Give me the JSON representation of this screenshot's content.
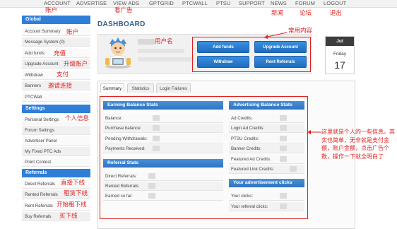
{
  "topnav": {
    "items": [
      "ACCOUNT",
      "ADVERTISE",
      "VIEW ADS",
      "GPTGRID",
      "PTCWALL",
      "PTSU",
      "SUPPORT",
      "NEWS",
      "FORUM",
      "LOGOUT"
    ]
  },
  "annotations": {
    "account": "账户",
    "view_ads": "看广告",
    "news": "新闻",
    "forum": "论坛",
    "logout": "退出",
    "username": "用户名",
    "common_content": "常用内容",
    "sidebar_account": "账户",
    "sidebar_recharge": "充值",
    "sidebar_upgrade": "升级账户",
    "sidebar_withdraw": "支付",
    "sidebar_banners": "邀请连接",
    "sidebar_personal": "个人信息",
    "sidebar_direct": "直接下线",
    "sidebar_rented": "租赁下线",
    "sidebar_rent": "开始租下线",
    "sidebar_buy": "买下线",
    "stats_note": "这里就是个人的一些信息。其实也简单，无非就是支付金额，账户金额，点击广告个数，操作一下就全明白了"
  },
  "sidebar": {
    "global_header": "Global",
    "global_items": [
      "Account Summary",
      "Message System (0)",
      "Add funds",
      "Upgrade Account",
      "Withdraw",
      "Banners",
      "PTCWall"
    ],
    "settings_header": "Settings",
    "settings_items": [
      "Personal Settings",
      "Forum Settings",
      "Advertiser Panel",
      "My Fixed PTC Ads",
      "Point Contest"
    ],
    "referrals_header": "Referrals",
    "referrals_items": [
      "Direct Referrals",
      "Rented Referrals",
      "Rent Referrals",
      "Buy Referrals"
    ]
  },
  "main": {
    "title": "DASHBOARD",
    "quick_buttons": [
      "Add funds",
      "Upgrade Account",
      "Withdraw",
      "Rent Referrals"
    ],
    "date": {
      "month": "Jul",
      "weekday": "Friday",
      "day": "17"
    },
    "tabs": [
      "Summary",
      "Statistics",
      "Login Failures"
    ],
    "earning_stats": {
      "title": "Earning Balance Stats",
      "rows": [
        "Balance:",
        "Purchase balance:",
        "Pending Withdrawals:",
        "Payments Received:"
      ]
    },
    "referral_stats": {
      "title": "Referral Stats",
      "rows": [
        "Direct Referrals:",
        "Rented Referrals:",
        "Earned so far:"
      ]
    },
    "advertising_stats": {
      "title": "Advertising Balance Stats",
      "rows": [
        "Ad Credits:",
        "Login Ad Credits:",
        "PTSU Credits:",
        "Banner Credits:",
        "Featured Ad Credits:",
        "Featured Link Credits:"
      ]
    },
    "ad_clicks": {
      "title": "Your advertisement clicks",
      "rows": [
        "Your clicks:",
        "Your referral clicks:"
      ]
    }
  },
  "colors": {
    "accent": "#2f7ed8",
    "annotation": "#e02020",
    "title": "#2f5f8a"
  }
}
